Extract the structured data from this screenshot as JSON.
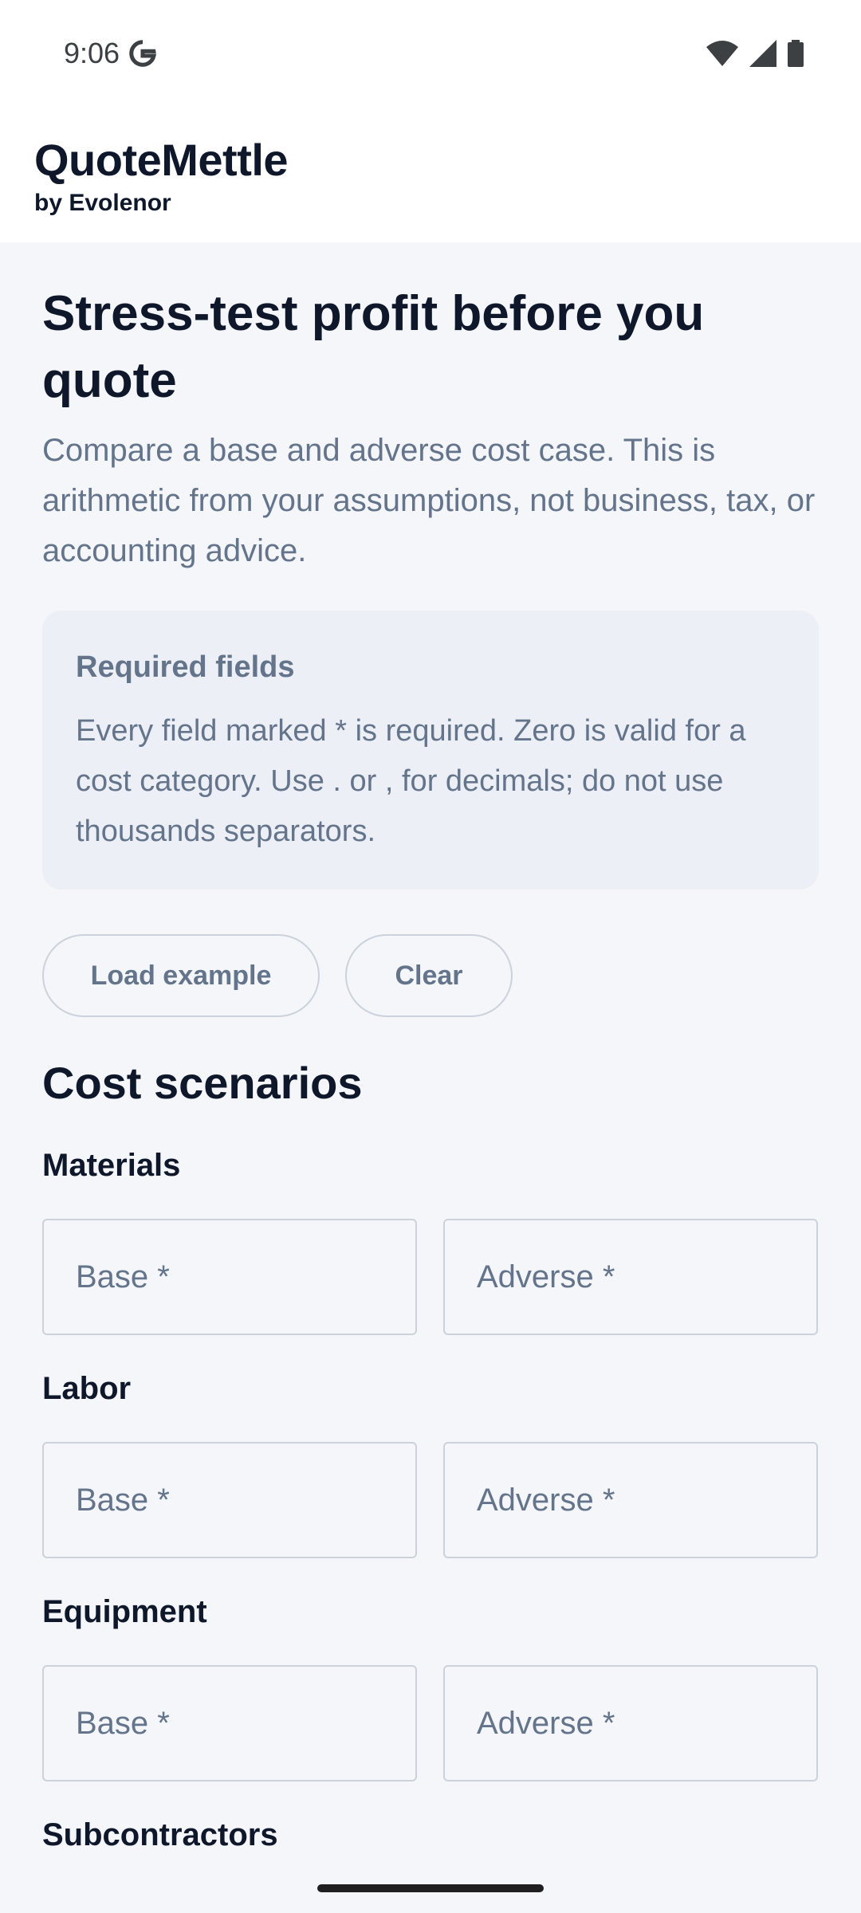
{
  "status_bar": {
    "time": "9:06",
    "icons": [
      "google-g-icon",
      "wifi-icon",
      "cell-signal-icon",
      "battery-icon"
    ]
  },
  "header": {
    "title": "QuoteMettle",
    "subtitle": "by Evolenor"
  },
  "hero": {
    "title": "Stress-test profit before you quote",
    "description": "Compare a base and adverse cost case. This is arithmetic from your assumptions, not business, tax, or accounting advice."
  },
  "required_card": {
    "title": "Required fields",
    "text": "Every field marked * is required. Zero is valid for a cost category. Use . or , for decimals; do not use thousands separators."
  },
  "actions": {
    "load_example": "Load example",
    "clear": "Clear"
  },
  "cost_scenarios": {
    "title": "Cost scenarios",
    "fields": [
      {
        "label": "Materials",
        "base_placeholder": "Base *",
        "adverse_placeholder": "Adverse *"
      },
      {
        "label": "Labor",
        "base_placeholder": "Base *",
        "adverse_placeholder": "Adverse *"
      },
      {
        "label": "Equipment",
        "base_placeholder": "Base *",
        "adverse_placeholder": "Adverse *"
      },
      {
        "label": "Subcontractors"
      }
    ]
  },
  "colors": {
    "background": "#f4f6fa",
    "text_primary": "#0f172a",
    "text_muted": "#64748b",
    "border": "#cbd2dc",
    "card": "#eceff6"
  }
}
